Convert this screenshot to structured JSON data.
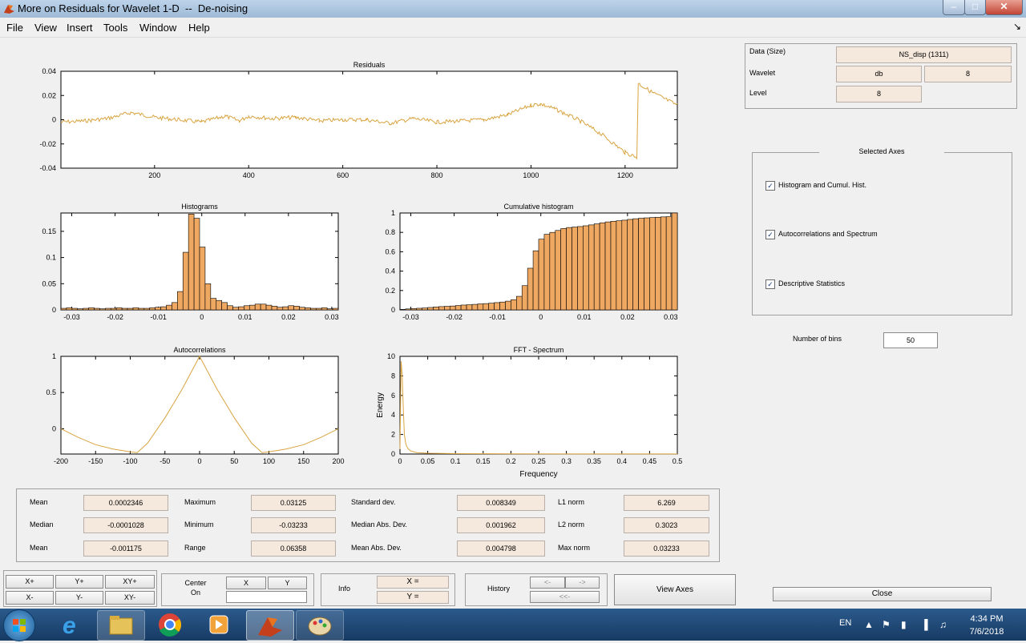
{
  "window": {
    "title": "More on Residuals for Wavelet 1-D  --  De-noising"
  },
  "menu": [
    "File",
    "View",
    "Insert",
    "Tools",
    "Window",
    "Help"
  ],
  "colors": {
    "signal": "#d9a441",
    "bar_fill": "#efa862",
    "panel_field": "#f5e8dc"
  },
  "right_panel": {
    "data_label": "Data  (Size)",
    "data_value": "NS_disp  (1311)",
    "wavelet_label": "Wavelet",
    "wavelet_family": "db",
    "wavelet_order": "8",
    "level_label": "Level",
    "level_value": "8",
    "selected_axes_title": "Selected Axes",
    "checks": [
      {
        "label": "Histogram and Cumul. Hist.",
        "checked": true
      },
      {
        "label": "Autocorrelations and Spectrum",
        "checked": true
      },
      {
        "label": "Descriptive Statistics",
        "checked": true
      }
    ],
    "bins_label": "Number of bins",
    "bins_value": "50"
  },
  "chart_data": [
    {
      "type": "line",
      "title": "Residuals",
      "xlim": [
        1,
        1311
      ],
      "ylim": [
        -0.04,
        0.04
      ],
      "x_ticks": [
        "200",
        "400",
        "600",
        "800",
        "1000",
        "1200"
      ],
      "y_ticks": [
        "0.04",
        "0.02",
        "0",
        "-0.02",
        "-0.04"
      ],
      "x": [
        1,
        50,
        100,
        150,
        200,
        250,
        300,
        350,
        380,
        400,
        450,
        500,
        550,
        600,
        650,
        700,
        750,
        800,
        850,
        900,
        950,
        1000,
        1020,
        1050,
        1100,
        1150,
        1200,
        1225,
        1228,
        1260,
        1311
      ],
      "values": [
        -0.002,
        -0.001,
        0.001,
        0.006,
        0.002,
        0.0,
        -0.002,
        0.003,
        -0.001,
        0.003,
        0.001,
        0.002,
        -0.001,
        0.0,
        0.0,
        -0.003,
        0.001,
        -0.002,
        -0.001,
        0.0,
        0.004,
        0.012,
        0.013,
        0.009,
        0.0,
        -0.012,
        -0.027,
        -0.031,
        0.03,
        0.022,
        0.012
      ]
    },
    {
      "type": "bar",
      "title": "Histograms",
      "xlim": [
        -0.0325,
        0.0315
      ],
      "ylim": [
        0,
        0.185
      ],
      "x_ticks": [
        "-0.03",
        "-0.02",
        "-0.01",
        "0",
        "0.01",
        "0.02",
        "0.03"
      ],
      "y_ticks": [
        "0.15",
        "0.1",
        "0.05",
        "0"
      ],
      "values": [
        0.003,
        0.004,
        0.003,
        0.002,
        0.003,
        0.004,
        0.003,
        0.002,
        0.003,
        0.003,
        0.004,
        0.003,
        0.003,
        0.004,
        0.003,
        0.003,
        0.004,
        0.005,
        0.006,
        0.009,
        0.014,
        0.035,
        0.11,
        0.183,
        0.175,
        0.12,
        0.05,
        0.022,
        0.018,
        0.014,
        0.008,
        0.005,
        0.006,
        0.008,
        0.009,
        0.011,
        0.011,
        0.009,
        0.007,
        0.005,
        0.006,
        0.008,
        0.007,
        0.005,
        0.004,
        0.003,
        0.003,
        0.004,
        0.002,
        0.003
      ]
    },
    {
      "type": "bar",
      "title": "Cumulative histogram",
      "xlim": [
        -0.0325,
        0.0315
      ],
      "ylim": [
        0,
        1
      ],
      "x_ticks": [
        "-0.03",
        "-0.02",
        "-0.01",
        "0",
        "0.01",
        "0.02",
        "0.03"
      ],
      "y_ticks": [
        "1",
        "0.8",
        "0.6",
        "0.4",
        "0.2",
        "0"
      ],
      "values": [
        0.005,
        0.01,
        0.014,
        0.017,
        0.02,
        0.025,
        0.03,
        0.034,
        0.037,
        0.04,
        0.045,
        0.05,
        0.053,
        0.057,
        0.062,
        0.065,
        0.069,
        0.075,
        0.081,
        0.09,
        0.105,
        0.14,
        0.25,
        0.43,
        0.61,
        0.73,
        0.78,
        0.8,
        0.82,
        0.84,
        0.85,
        0.855,
        0.86,
        0.868,
        0.877,
        0.888,
        0.899,
        0.908,
        0.915,
        0.92,
        0.926,
        0.934,
        0.941,
        0.946,
        0.95,
        0.953,
        0.956,
        0.96,
        0.962,
        1.0
      ]
    },
    {
      "type": "line",
      "title": "Autocorrelations",
      "xlim": [
        -200,
        200
      ],
      "ylim": [
        -0.35,
        1
      ],
      "x_ticks": [
        "-200",
        "-150",
        "-100",
        "-50",
        "0",
        "50",
        "100",
        "150",
        "200"
      ],
      "y_ticks": [
        "1",
        "0.5",
        "0"
      ],
      "x": [
        -200,
        -175,
        -150,
        -125,
        -100,
        -90,
        -75,
        -50,
        -25,
        0,
        25,
        50,
        75,
        90,
        100,
        125,
        150,
        175,
        200
      ],
      "values": [
        0.0,
        -0.12,
        -0.22,
        -0.28,
        -0.32,
        -0.33,
        -0.2,
        0.15,
        0.55,
        1.0,
        0.55,
        0.15,
        -0.2,
        -0.33,
        -0.32,
        -0.28,
        -0.22,
        -0.12,
        0.0
      ]
    },
    {
      "type": "line",
      "title": "FFT - Spectrum",
      "xlabel": "Frequency",
      "ylabel": "Energy",
      "xlim": [
        0,
        0.5
      ],
      "ylim": [
        0,
        10
      ],
      "x_ticks": [
        "0",
        "0.05",
        "0.1",
        "0.15",
        "0.2",
        "0.25",
        "0.3",
        "0.35",
        "0.4",
        "0.45",
        "0.5"
      ],
      "y_ticks": [
        "10",
        "8",
        "6",
        "4",
        "2",
        "0"
      ],
      "x": [
        0.0,
        0.002,
        0.004,
        0.006,
        0.008,
        0.01,
        0.012,
        0.015,
        0.02,
        0.03,
        0.05,
        0.1,
        0.2,
        0.3,
        0.4,
        0.5
      ],
      "values": [
        0.5,
        9.5,
        8.0,
        4.5,
        2.0,
        1.2,
        0.8,
        0.5,
        0.3,
        0.15,
        0.08,
        0.04,
        0.02,
        0.01,
        0.01,
        0.01
      ]
    }
  ],
  "stats": [
    {
      "label": "Mean",
      "value": "0.0002346"
    },
    {
      "label": "Maximum",
      "value": "0.03125"
    },
    {
      "label": "Standard dev.",
      "value": "0.008349"
    },
    {
      "label": "L1 norm",
      "value": "6.269"
    },
    {
      "label": "Median",
      "value": "-0.0001028"
    },
    {
      "label": "Minimum",
      "value": "-0.03233"
    },
    {
      "label": "Median Abs. Dev.",
      "value": "0.001962"
    },
    {
      "label": "L2 norm",
      "value": "0.3023"
    },
    {
      "label": "Mean",
      "value": "-0.001175"
    },
    {
      "label": "Range",
      "value": "0.06358"
    },
    {
      "label": "Mean Abs. Dev.",
      "value": "0.004798"
    },
    {
      "label": "Max norm",
      "value": "0.03233"
    }
  ],
  "zoom": {
    "x_plus": "X+",
    "y_plus": "Y+",
    "xy_plus": "XY+",
    "x_minus": "X-",
    "y_minus": "Y-",
    "xy_minus": "XY-"
  },
  "center": {
    "label": "Center\nOn",
    "x": "X",
    "y": "Y"
  },
  "info": {
    "label": "Info",
    "x": "X =",
    "y": "Y ="
  },
  "history": {
    "label": "History",
    "back": "<-",
    "fwd": "->",
    "reset": "<<-"
  },
  "view_axes": "View Axes",
  "close": "Close",
  "taskbar": {
    "lang": "EN",
    "time": "4:34 PM",
    "date": "7/6/2018"
  }
}
